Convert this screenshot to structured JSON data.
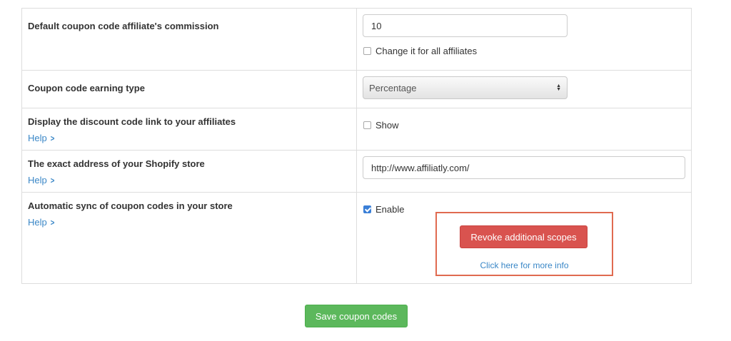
{
  "rows": {
    "commission": {
      "label": "Default coupon code affiliate's commission",
      "value": "10",
      "change_all_label": "Change it for all affiliates",
      "change_all_checked": false
    },
    "earning_type": {
      "label": "Coupon code earning type",
      "selected": "Percentage"
    },
    "display_link": {
      "label": "Display the discount code link to your affiliates",
      "help": "Help",
      "show_label": "Show",
      "show_checked": false
    },
    "store_address": {
      "label": "The exact address of your Shopify store",
      "help": "Help",
      "value": "http://www.affiliatly.com/"
    },
    "auto_sync": {
      "label": "Automatic sync of coupon codes in your store",
      "help": "Help",
      "enable_label": "Enable",
      "enable_checked": true,
      "revoke_label": "Revoke additional scopes",
      "more_info": "Click here for more info"
    }
  },
  "save_label": "Save coupon codes",
  "icons": {
    "help": "chevron-right-icon",
    "select": "select-arrows-icon",
    "check": "checkmark-icon"
  },
  "colors": {
    "link": "#3a87c7",
    "danger": "#d9534f",
    "success": "#5cb85c",
    "highlight_border": "#e06a50",
    "checkbox_checked": "#3a7fd7"
  }
}
